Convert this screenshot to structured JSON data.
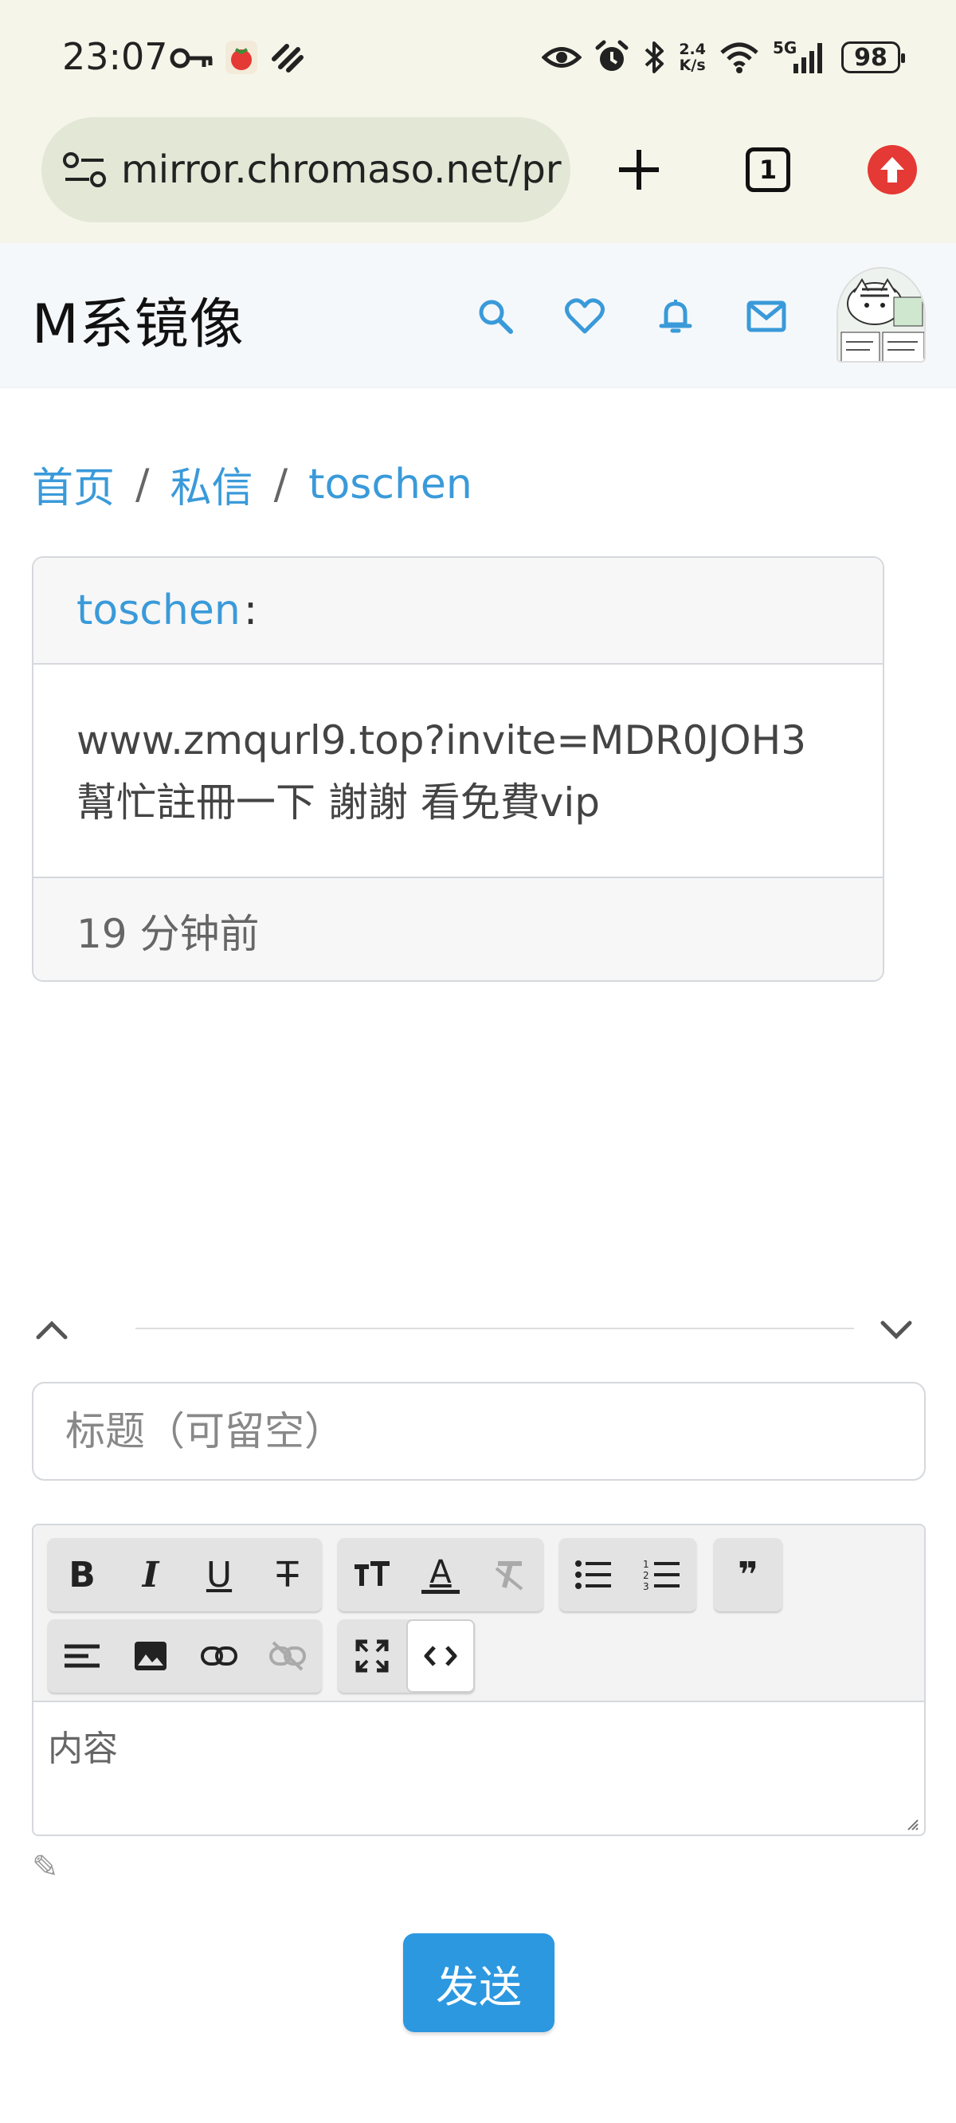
{
  "status_bar": {
    "time": "23:07",
    "net_speed_value": "2.4",
    "net_speed_unit": "K/s",
    "network": "5G",
    "battery": "98"
  },
  "browser": {
    "url": "mirror.chromaso.net/pr",
    "tab_count": "1"
  },
  "site": {
    "title": "M系镜像"
  },
  "breadcrumb": {
    "home": "首页",
    "sep1": "/",
    "messages": "私信",
    "sep2": "/",
    "user": "toschen"
  },
  "message": {
    "sender": "toschen",
    "colon": ":",
    "line1": "www.zmqurl9.top?invite=MDR0JOH3",
    "line2": "幫忙註冊一下 謝謝 看免費vip",
    "time_ago": "19 分钟前"
  },
  "reply": {
    "title_placeholder": "标题（可留空）",
    "content_placeholder": "内容",
    "send_label": "发送"
  },
  "toolbar": {
    "bold": "B",
    "italic": "I",
    "underline": "U",
    "strike": "T",
    "font_color": "A",
    "quote": "❞"
  },
  "colors": {
    "accent": "#3a9ad9",
    "send_button": "#2c98e0",
    "browser_chrome": "#f5f6e9",
    "update_badge": "#e53935"
  }
}
